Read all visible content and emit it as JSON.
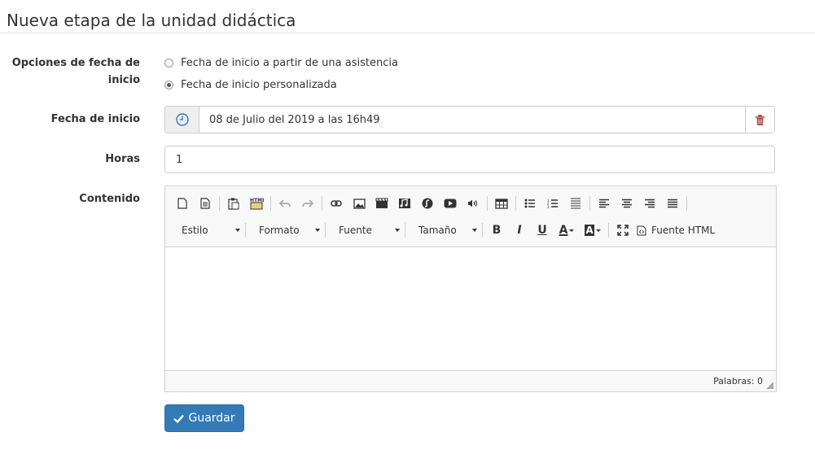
{
  "page": {
    "title": "Nueva etapa de la unidad didáctica"
  },
  "form": {
    "date_options": {
      "label_line1": "Opciones de fecha de",
      "label_line2": "inicio",
      "options": [
        {
          "label": "Fecha de inicio a partir de una asistencia",
          "checked": false
        },
        {
          "label": "Fecha de inicio personalizada",
          "checked": true
        }
      ]
    },
    "start_date": {
      "label": "Fecha de inicio",
      "value": "08 de Julio del 2019 a las 16h49"
    },
    "hours": {
      "label": "Horas",
      "value": "1"
    },
    "content": {
      "label": "Contenido"
    }
  },
  "editor": {
    "combos": {
      "style": "Estilo",
      "format": "Formato",
      "font": "Fuente",
      "size": "Tamaño"
    },
    "bold": "B",
    "italic": "I",
    "underline": "U",
    "text_color": "A",
    "bg_color": "A",
    "source_label": "Fuente HTML",
    "word_count": "Palabras: 0"
  },
  "actions": {
    "save_label": "Guardar"
  },
  "colors": {
    "primary": "#337ab7",
    "danger": "#a94442",
    "clock": "#337ab7"
  }
}
